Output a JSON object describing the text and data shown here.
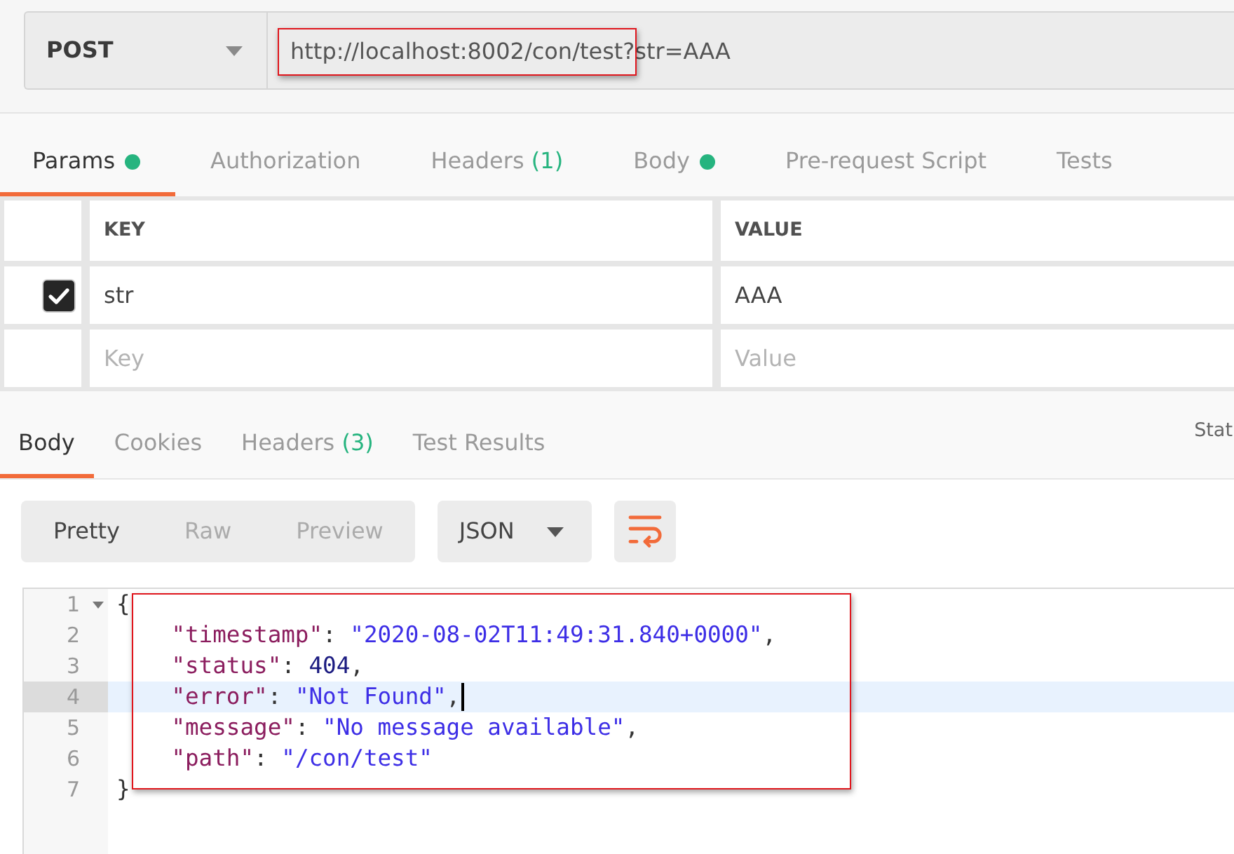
{
  "request": {
    "method": "POST",
    "url": "http://localhost:8002/con/test?str=AAA",
    "url_annotated": true
  },
  "request_tabs": [
    {
      "label": "Params",
      "selected": true,
      "dot": true
    },
    {
      "label": "Authorization",
      "selected": false,
      "dot": false
    },
    {
      "label": "Headers",
      "count": "(1)",
      "selected": false,
      "dot": false
    },
    {
      "label": "Body",
      "selected": false,
      "dot": true
    },
    {
      "label": "Pre-request Script",
      "selected": false,
      "dot": false
    },
    {
      "label": "Tests",
      "selected": false,
      "dot": false
    }
  ],
  "params": {
    "columns": [
      "KEY",
      "VALUE"
    ],
    "rows": [
      {
        "checked": true,
        "key": "str",
        "value": "AAA"
      }
    ],
    "new_row": {
      "key_placeholder": "Key",
      "value_placeholder": "Value"
    }
  },
  "response_tabs": [
    {
      "label": "Body",
      "selected": true
    },
    {
      "label": "Cookies",
      "selected": false
    },
    {
      "label": "Headers",
      "count": "(3)",
      "selected": false
    },
    {
      "label": "Test Results",
      "selected": false
    }
  ],
  "status_label": "Stat",
  "view_modes": [
    {
      "label": "Pretty",
      "selected": true
    },
    {
      "label": "Raw",
      "selected": false
    },
    {
      "label": "Preview",
      "selected": false
    }
  ],
  "format": "JSON",
  "editor": {
    "annotated": true,
    "lines": [
      {
        "number": "1",
        "foldable": true,
        "indented": false,
        "current": false,
        "tokens": [
          {
            "kind": "punct",
            "text": "{"
          }
        ]
      },
      {
        "number": "2",
        "foldable": false,
        "indented": true,
        "current": false,
        "tokens": [
          {
            "kind": "key",
            "text": "\"timestamp\""
          },
          {
            "kind": "punct",
            "text": ": "
          },
          {
            "kind": "string",
            "text": "\"2020-08-02T11:49:31.840+0000\""
          },
          {
            "kind": "punct",
            "text": ","
          }
        ]
      },
      {
        "number": "3",
        "foldable": false,
        "indented": true,
        "current": false,
        "tokens": [
          {
            "kind": "key",
            "text": "\"status\""
          },
          {
            "kind": "punct",
            "text": ": "
          },
          {
            "kind": "number",
            "text": "404"
          },
          {
            "kind": "punct",
            "text": ","
          }
        ]
      },
      {
        "number": "4",
        "foldable": false,
        "indented": true,
        "current": true,
        "tokens": [
          {
            "kind": "key",
            "text": "\"error\""
          },
          {
            "kind": "punct",
            "text": ": "
          },
          {
            "kind": "string",
            "text": "\"Not Found\""
          },
          {
            "kind": "punct",
            "text": ","
          }
        ]
      },
      {
        "number": "5",
        "foldable": false,
        "indented": true,
        "current": false,
        "tokens": [
          {
            "kind": "key",
            "text": "\"message\""
          },
          {
            "kind": "punct",
            "text": ": "
          },
          {
            "kind": "string",
            "text": "\"No message available\""
          },
          {
            "kind": "punct",
            "text": ","
          }
        ]
      },
      {
        "number": "6",
        "foldable": false,
        "indented": true,
        "current": false,
        "tokens": [
          {
            "kind": "key",
            "text": "\"path\""
          },
          {
            "kind": "punct",
            "text": ": "
          },
          {
            "kind": "string",
            "text": "\"/con/test\""
          }
        ]
      },
      {
        "number": "7",
        "foldable": false,
        "indented": false,
        "current": false,
        "tokens": [
          {
            "kind": "punct",
            "text": "}"
          }
        ]
      }
    ]
  }
}
